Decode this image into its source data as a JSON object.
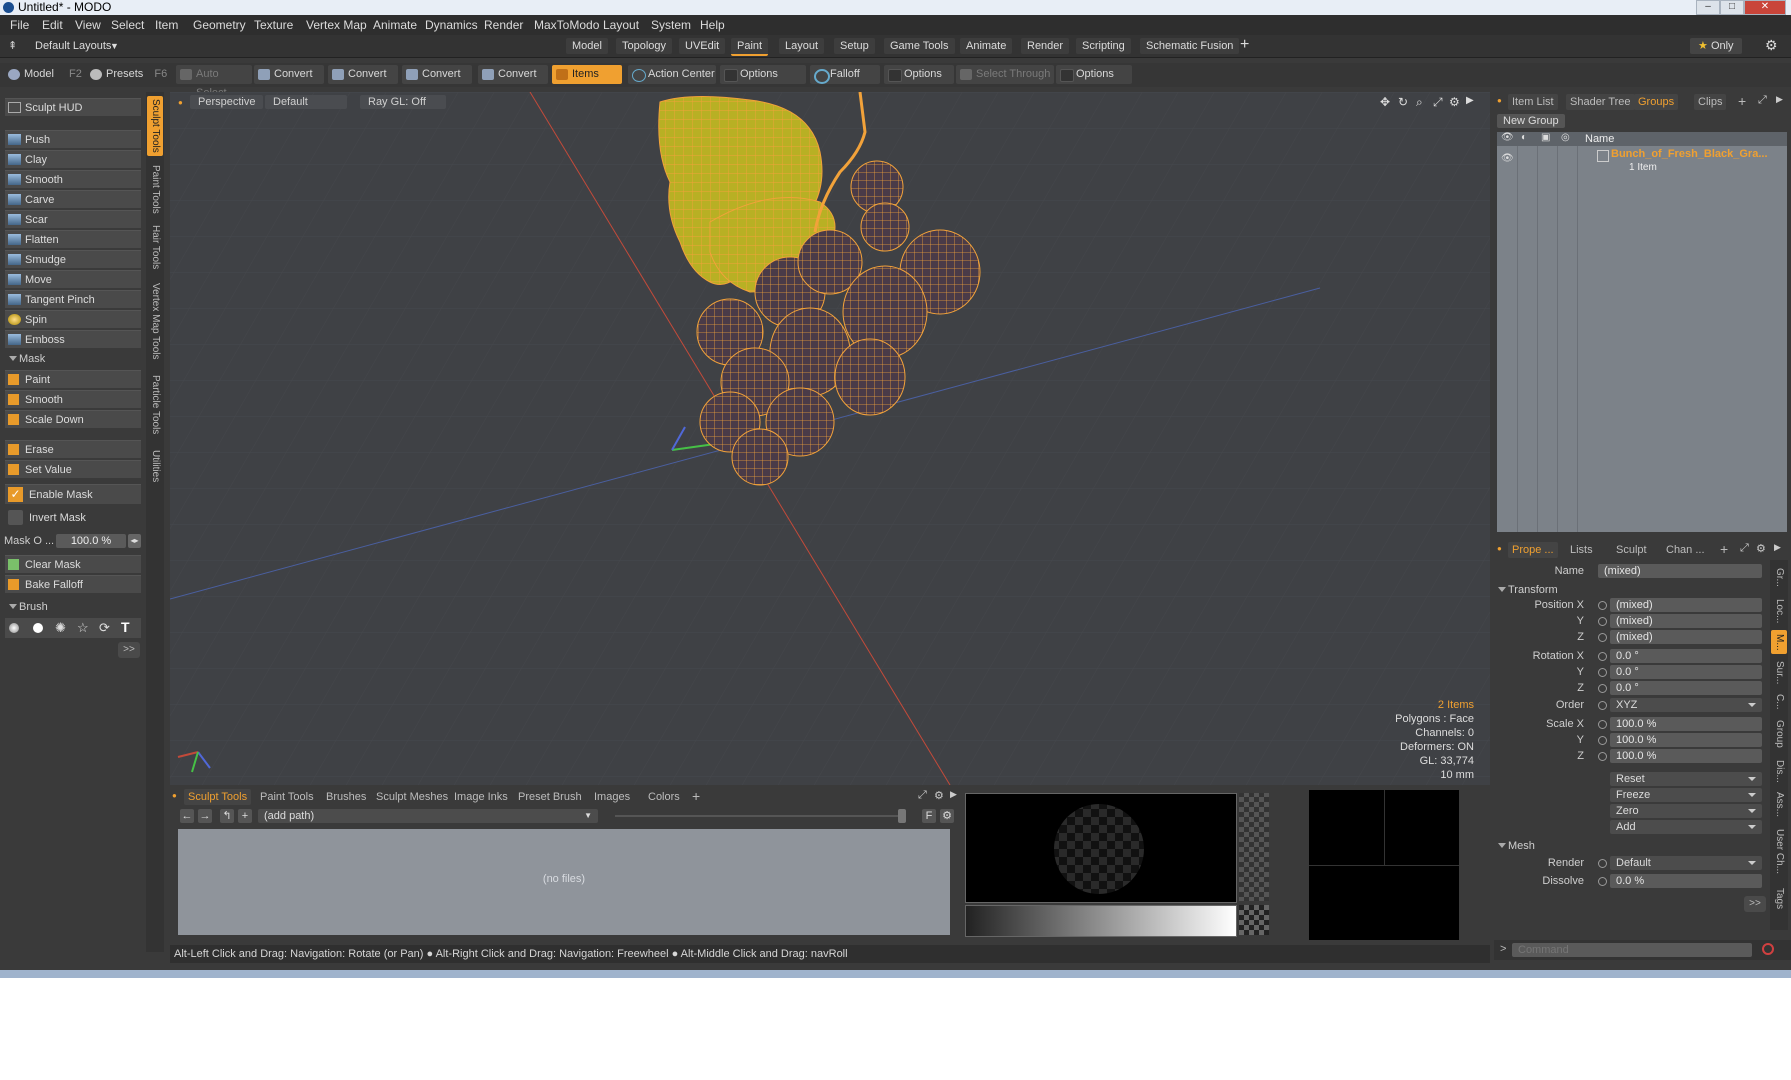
{
  "window": {
    "title": "Untitled* - MODO"
  },
  "menu": [
    "File",
    "Edit",
    "View",
    "Select",
    "Item",
    "Geometry",
    "Texture",
    "Vertex Map",
    "Animate",
    "Dynamics",
    "Render",
    "MaxToModo",
    "Layout",
    "System",
    "Help"
  ],
  "layoutbar": {
    "layouts_label": "Default Layouts",
    "tabs": [
      "Model",
      "Topology",
      "UVEdit",
      "Paint",
      "Layout",
      "Setup",
      "Game Tools",
      "Animate",
      "Render",
      "Scripting",
      "Schematic Fusion"
    ],
    "active_tab": "Paint",
    "only_label": "Only"
  },
  "toolbar": {
    "model": "Model",
    "model_key": "F2",
    "presets": "Presets",
    "presets_key": "F6",
    "auto_select": "Auto Select",
    "convert": "Convert",
    "items": "Items",
    "action_center": "Action Center",
    "options": "Options",
    "falloff": "Falloff",
    "select_through": "Select Through"
  },
  "left_panel": {
    "hud": "Sculpt HUD",
    "tools": [
      "Push",
      "Clay",
      "Smooth",
      "Carve",
      "Scar",
      "Flatten",
      "Smudge",
      "Move",
      "Tangent Pinch",
      "Spin",
      "Emboss"
    ],
    "mask_header": "Mask",
    "mask_tools": [
      "Paint",
      "Smooth",
      "Scale Down"
    ],
    "erase": "Erase",
    "set_value": "Set Value",
    "enable_mask": "Enable Mask",
    "invert_mask": "Invert Mask",
    "mask_opacity_label": "Mask O ...",
    "mask_opacity_value": "100.0 %",
    "clear_mask": "Clear Mask",
    "bake_falloff": "Bake Falloff",
    "brush_header": "Brush",
    "more": ">>"
  },
  "vertical_tabs": [
    "Sculpt Tools",
    "Paint Tools",
    "Hair Tools",
    "Vertex Map Tools",
    "Particle Tools",
    "Utilities"
  ],
  "viewport": {
    "projection": "Perspective",
    "shading": "Default",
    "raygl": "Ray GL: Off",
    "stats": {
      "items": "2 Items",
      "polygons": "Polygons : Face",
      "channels": "Channels: 0",
      "deformers": "Deformers: ON",
      "gl": "GL: 33,774",
      "scale": "10 mm"
    }
  },
  "browser": {
    "tabs": [
      "Sculpt Tools",
      "Paint Tools",
      "Brushes",
      "Sculpt Meshes",
      "Image Inks",
      "Preset Brush",
      "Images",
      "Colors"
    ],
    "path": "(add path)",
    "empty": "(no files)",
    "f_label": "F"
  },
  "right_top": {
    "tabs": [
      "Item List",
      "Shader Tree",
      "Groups",
      "Clips"
    ],
    "new_group": "New Group",
    "name_col": "Name",
    "group_name": "Bunch_of_Fresh_Black_Gra...",
    "group_count": "1 Item"
  },
  "props": {
    "tabs": [
      "Prope ...",
      "Lists",
      "Sculpt",
      "Chan ..."
    ],
    "name_label": "Name",
    "name_value": "(mixed)",
    "transform_header": "Transform",
    "position_label": "Position X",
    "pos_x": "(mixed)",
    "pos_y": "(mixed)",
    "pos_z": "(mixed)",
    "rotation_label": "Rotation X",
    "rot_x": "0.0 °",
    "rot_y": "0.0 °",
    "rot_z": "0.0 °",
    "order_label": "Order",
    "order_value": "XYZ",
    "scale_label": "Scale X",
    "scl_x": "100.0 %",
    "scl_y": "100.0 %",
    "scl_z": "100.0 %",
    "y": "Y",
    "z": "Z",
    "reset": "Reset",
    "freeze": "Freeze",
    "zero": "Zero",
    "add": "Add",
    "mesh_header": "Mesh",
    "render_label": "Render",
    "render_value": "Default",
    "dissolve_label": "Dissolve",
    "dissolve_value": "0.0 %",
    "more": ">>",
    "side_tabs": [
      "Gr...",
      "Loc...",
      "M...",
      "Sur...",
      "C...",
      "Group",
      "Dis...",
      "Ass...",
      "User Ch...",
      "Tags"
    ]
  },
  "command": {
    "placeholder": "Command",
    "prompt": ">"
  },
  "status": "Alt-Left Click and Drag: Navigation: Rotate (or Pan) ● Alt-Right Click and Drag: Navigation: Freewheel ● Alt-Middle Click and Drag: navRoll",
  "colors": {
    "accent": "#f0a030",
    "panel": "#3a3a3a",
    "viewport": "#3f4145",
    "wire": "#f2a23a"
  }
}
